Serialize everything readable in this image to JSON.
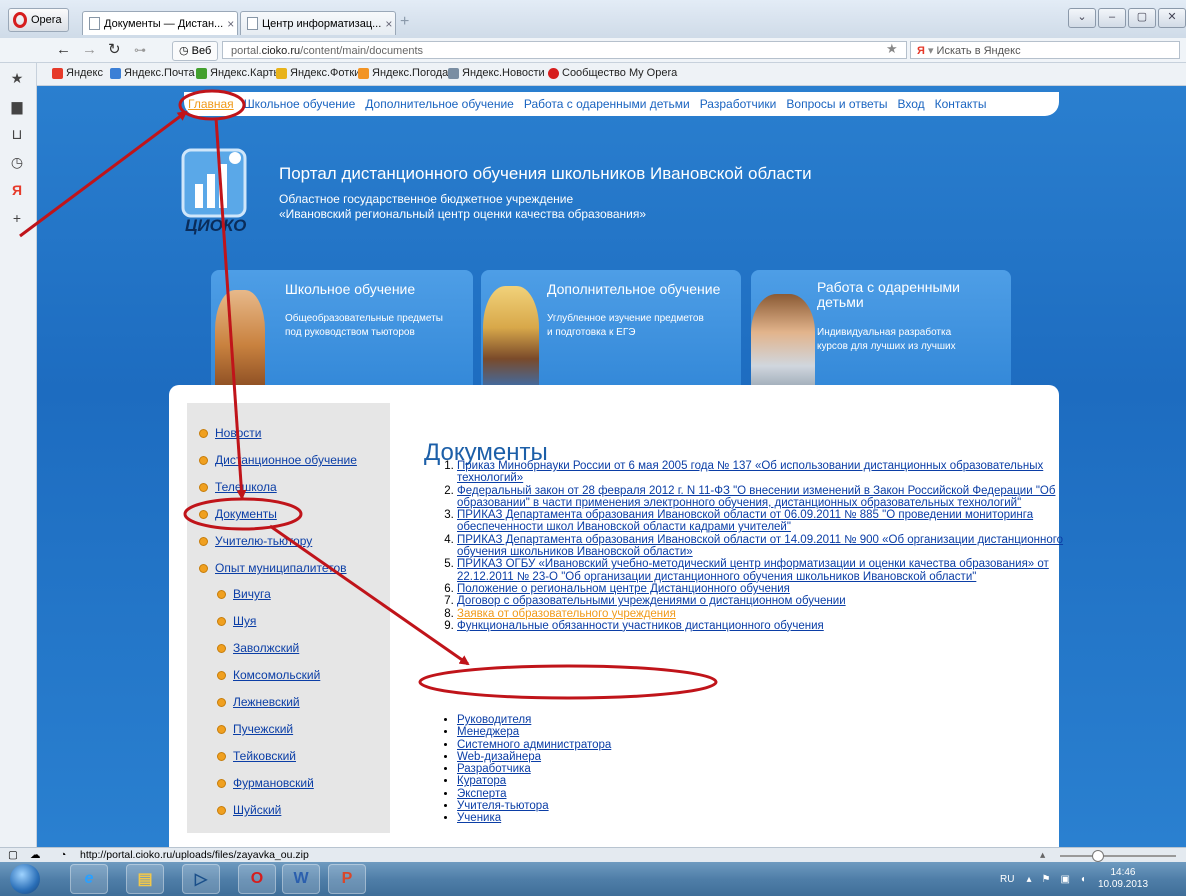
{
  "browser": {
    "opera_button": "Opera",
    "tabs": [
      {
        "label": "Документы — Дистан...",
        "close": "×"
      },
      {
        "label": "Центр информатизац...",
        "close": "×"
      }
    ],
    "new_tab": "+",
    "window_controls": [
      "⌄",
      "–",
      "▢",
      "✕"
    ],
    "site_button": "Веб",
    "url_prefix": "portal.",
    "url_domain": "cioko.ru",
    "url_path": "/content/main/documents",
    "search_placeholder": "Искать в Яндекс",
    "search_engine": "Я",
    "bookmarks": [
      {
        "label": "Яндекс",
        "color": "#e63a2a"
      },
      {
        "label": "Яндекс.Почта",
        "color": "#3b7fd6"
      },
      {
        "label": "Яндекс.Карты",
        "color": "#43a02f"
      },
      {
        "label": "Яндекс.Фотки",
        "color": "#e8b31a"
      },
      {
        "label": "Яндекс.Погода",
        "color": "#f29424"
      },
      {
        "label": "Яндекс.Новости",
        "color": "#7a8ea3"
      },
      {
        "label": "Сообщество My Opera",
        "color": "#d61d1d"
      }
    ]
  },
  "site": {
    "top_menu": [
      "Главная",
      "Школьное обучение",
      "Дополнительное обучение",
      "Работа с одаренными детьми",
      "Разработчики",
      "Вопросы и ответы",
      "Вход",
      "Контакты"
    ],
    "logo_text": "ЦИОКО",
    "title": "Портал дистанционного обучения школьников Ивановской области",
    "subtitle_line1": "Областное государственное бюджетное учреждение",
    "subtitle_line2": "«Ивановский региональный центр оценки качества образования»",
    "promos": [
      {
        "title": "Школьное обучение",
        "text1": "Общеобразовательные предметы",
        "text2": "под руководством тьюторов"
      },
      {
        "title": "Дополнительное обучение",
        "text1": "Углубленное изучение предметов",
        "text2": "и подготовка к ЕГЭ"
      },
      {
        "title": "Работа с одаренными",
        "title2": "детьми",
        "text1": "Индивидуальная разработка",
        "text2": "курсов для лучших из лучших"
      }
    ],
    "left_nav": {
      "items": [
        "Новости",
        "Дистанционное обучение",
        "Телешкола",
        "Документы",
        "Учителю-тьютору",
        "Опыт муниципалитетов"
      ],
      "sub_items": [
        "Вичуга",
        "Шуя",
        "Заволжский",
        "Комсомольский",
        "Лежневский",
        "Пучежский",
        "Тейковский",
        "Фурмановский",
        "Шуйский"
      ]
    },
    "page_title": "Документы",
    "documents": [
      "Приказ Минобрнауки России от 6 мая 2005 года № 137 «Об использовании дистанционных образовательных технологий»",
      "Федеральный закон от 28 февраля 2012 г. N 11-ФЗ \"О внесении изменений в Закон Российской Федерации \"Об образовании\" в части применения электронного обучения, дистанционных образовательных технологий\"",
      "ПРИКАЗ Департамента образования Ивановской области от 06.09.2011 № 885 \"О проведении мониторинга обеспеченности школ Ивановской области кадрами учителей\"",
      "ПРИКАЗ Департамента образования Ивановской области от 14.09.2011 № 900 «Об организации дистанционного обучения школьников Ивановской области»",
      "ПРИКАЗ ОГБУ «Ивановский учебно-методический центр информатизации и оценки качества образования» от 22.12.2011 № 23-О \"Об организации дистанционного обучения школьников Ивановской области\"",
      "Положение о региональном центре Дистанционного обучения",
      "Договор с образовательными учреждениями о дистанционном обучении",
      "Заявка от образовательного учреждения",
      "Функциональные обязанности участников дистанционного обучения"
    ],
    "roles": [
      "Руководителя",
      "Менеджера",
      "Системного администратора",
      "Web-дизайнера",
      "Разработчика",
      "Куратора",
      "Эксперта",
      "Учителя-тьютора",
      "Ученика"
    ]
  },
  "status": {
    "url": "http://portal.cioko.ru/uploads/files/zayavka_ou.zip"
  },
  "taskbar": {
    "lang": "RU",
    "time": "14:46",
    "date": "10.09.2013"
  },
  "colors": {
    "accent_orange": "#f09a1a",
    "link_blue": "#0b3ea6",
    "annotation_red": "#c0141a",
    "page_blue": "#2a7fcf"
  }
}
